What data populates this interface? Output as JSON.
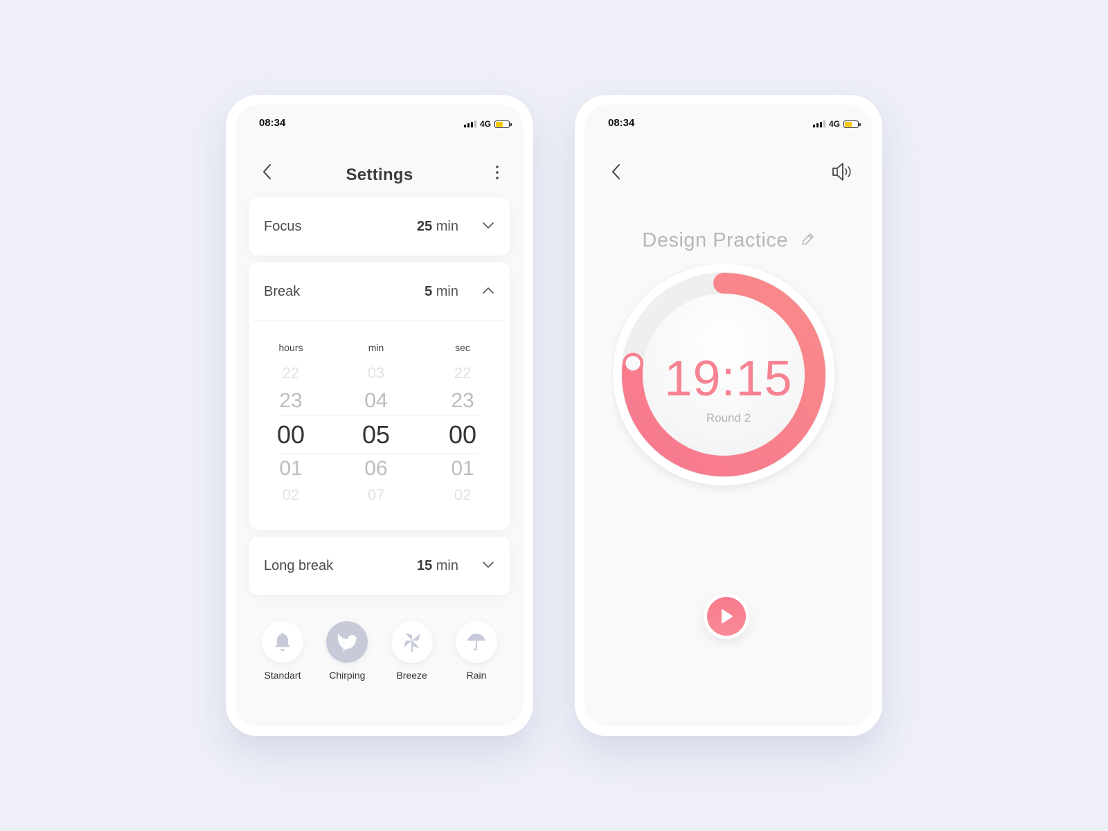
{
  "colors": {
    "background": "#eeeff7",
    "accent": "#f68391",
    "battery": "#f6c900",
    "active_sound": "#c7cad9"
  },
  "settings_screen": {
    "status": {
      "time": "08:34",
      "network": "4G",
      "battery_level": 0.55
    },
    "header": {
      "title": "Settings",
      "back_icon": "chevron-left-icon",
      "menu_icon": "more-vertical-icon"
    },
    "sections": [
      {
        "label": "Focus",
        "value": "25",
        "unit": "min",
        "expanded": false
      },
      {
        "label": "Break",
        "value": "5",
        "unit": "min",
        "expanded": true
      },
      {
        "label": "Long break",
        "value": "15",
        "unit": "min",
        "expanded": false
      }
    ],
    "picker": {
      "columns": [
        {
          "header": "hours",
          "values": [
            "22",
            "23",
            "00",
            "01",
            "02"
          ],
          "selected": "00"
        },
        {
          "header": "min",
          "values": [
            "03",
            "04",
            "05",
            "06",
            "07"
          ],
          "selected": "05"
        },
        {
          "header": "sec",
          "values": [
            "22",
            "23",
            "00",
            "01",
            "02"
          ],
          "selected": "00"
        }
      ]
    },
    "sounds": [
      {
        "label": "Standart",
        "icon": "bell-icon",
        "active": false
      },
      {
        "label": "Chirping",
        "icon": "bird-icon",
        "active": true
      },
      {
        "label": "Breeze",
        "icon": "pinwheel-icon",
        "active": false
      },
      {
        "label": "Rain",
        "icon": "umbrella-icon",
        "active": false
      }
    ]
  },
  "timer_screen": {
    "status": {
      "time": "08:34",
      "network": "4G",
      "battery_level": 0.55
    },
    "header": {
      "back_icon": "chevron-left-icon",
      "sound_icon": "speaker-icon"
    },
    "task_name": "Design Practice",
    "edit_icon": "pencil-icon",
    "time_remaining": "19:15",
    "round": "Round 2",
    "progress_fraction": 0.77,
    "play_icon": "play-icon"
  }
}
